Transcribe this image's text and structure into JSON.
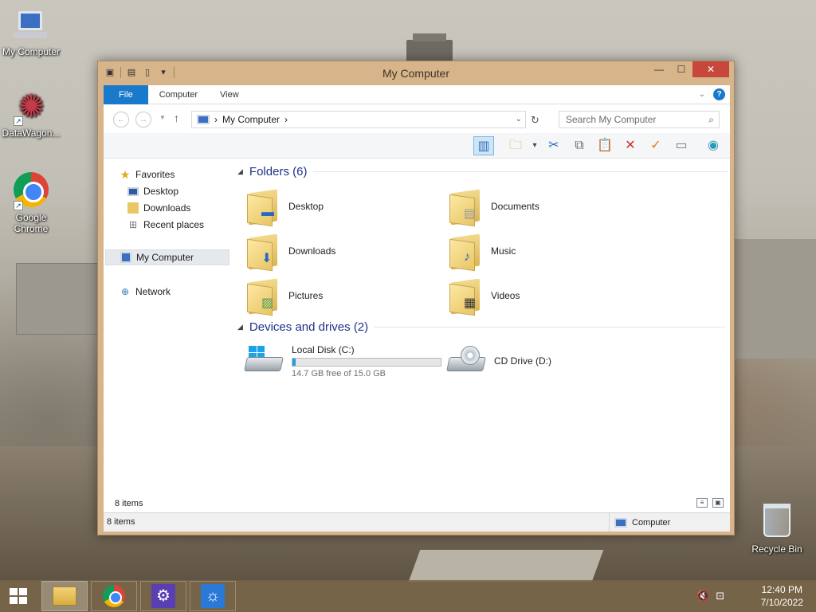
{
  "desktop": {
    "icons": [
      {
        "label": "My Computer"
      },
      {
        "label": "DataWagon..."
      },
      {
        "label": "Google Chrome"
      },
      {
        "label": "Recycle Bin"
      }
    ]
  },
  "window": {
    "title": "My Computer",
    "controls": {
      "minimize": "—",
      "maximize": "☐",
      "close": "✕"
    },
    "ribbon_tabs": [
      "File",
      "Computer",
      "View"
    ],
    "address": {
      "location": "My Computer",
      "separator": "›"
    },
    "search": {
      "placeholder": "Search My Computer"
    },
    "toolbar_icons": [
      "preview-pane-icon",
      "folder-options-icon",
      "cut-icon",
      "copy-icon",
      "paste-icon",
      "delete-icon",
      "select-icon",
      "rename-icon",
      "web-icon"
    ]
  },
  "navpane": {
    "items": [
      {
        "label": "Favorites"
      },
      {
        "label": "Desktop"
      },
      {
        "label": "Downloads"
      },
      {
        "label": "Recent places"
      },
      {
        "label": "My Computer"
      },
      {
        "label": "Network"
      }
    ]
  },
  "main": {
    "folders_header": "Folders (6)",
    "folders": [
      {
        "label": "Desktop"
      },
      {
        "label": "Documents"
      },
      {
        "label": "Downloads"
      },
      {
        "label": "Music"
      },
      {
        "label": "Pictures"
      },
      {
        "label": "Videos"
      }
    ],
    "drives_header": "Devices and drives (2)",
    "drives": [
      {
        "label": "Local Disk (C:)",
        "free_text": "14.7 GB free of 15.0 GB",
        "used_fraction": 0.02
      },
      {
        "label": "CD Drive (D:)"
      }
    ]
  },
  "status": {
    "items_inner": "8 items",
    "items_outer": "8 items",
    "zone": "Computer"
  },
  "taskbar": {
    "apps": [
      "file-explorer",
      "google-chrome",
      "settings",
      "weather"
    ],
    "time": "12:40 PM",
    "date": "7/10/2022"
  },
  "colors": {
    "accent": "#1979ca",
    "window_frame": "#d8b48a",
    "close_button": "#c7473a",
    "heading": "#1e3287",
    "capacity_fill": "#26a0da"
  }
}
